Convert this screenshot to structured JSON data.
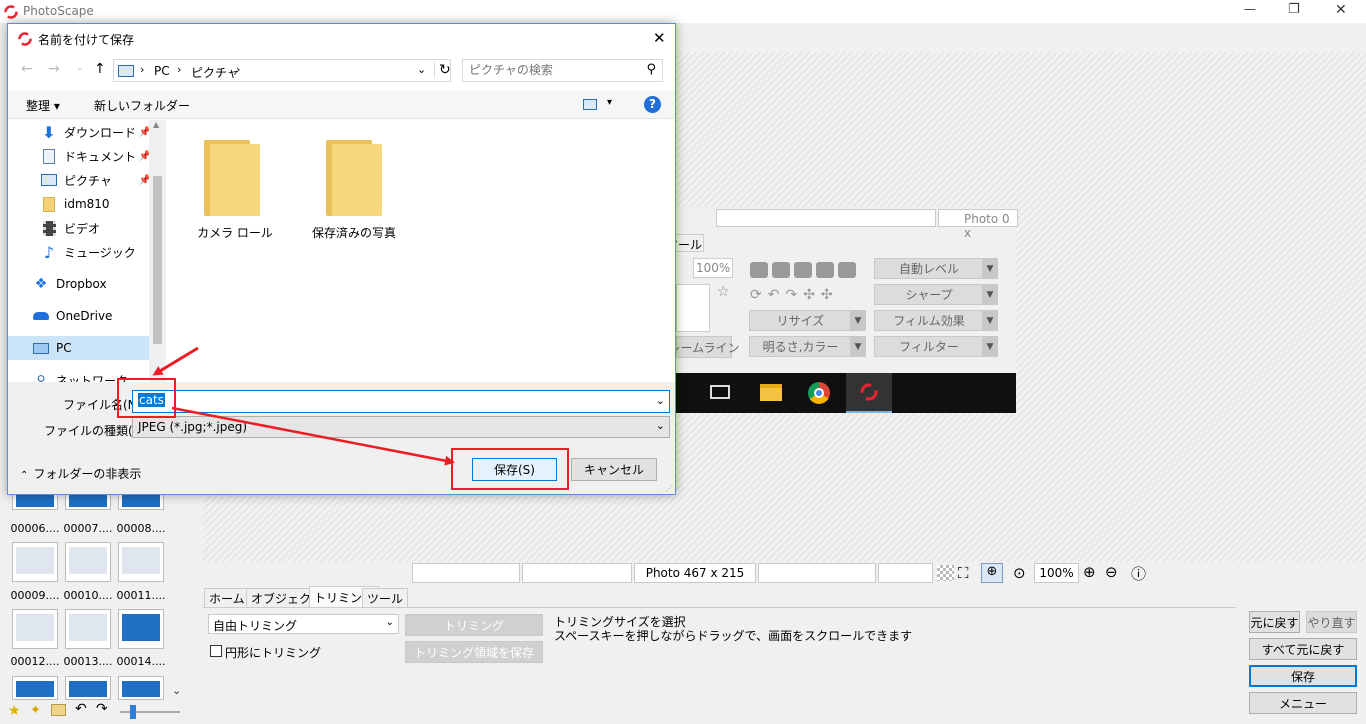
{
  "app": {
    "title": "PhotoScape",
    "win_min": "—",
    "win_max": "❐",
    "win_close": "✕"
  },
  "editor": {
    "info_photo": "Photo 467 x 215",
    "zoom": "100%",
    "tabs": [
      "ホーム",
      "オブジェクト",
      "トリミング",
      "ツール"
    ],
    "crop_select": "自由トリミング",
    "crop_btn": "トリミング",
    "crop_save_btn": "トリミング領域を保存",
    "circle_crop": "円形にトリミング",
    "hint_line1": "トリミングサイズを選択",
    "hint_line2": "スペースキーを押しながらドラッグで、画面をスクロールできます",
    "undo": "元に戻す",
    "redo": "やり直す",
    "undo_all": "すべて元に戻す",
    "save": "保存",
    "menu": "メニュー"
  },
  "inner": {
    "photo_info": "Photo 0 x",
    "tab_partial": "ツール",
    "zoom": "100%",
    "auto_level": "自動レベル",
    "sharpen": "シャープ",
    "resize": "リサイズ",
    "film": "フィルム効果",
    "bright": "明るさ,カラー",
    "filter": "フィルター",
    "frame_partial": "レームライン"
  },
  "thumbs": {
    "labels": [
      "00006....",
      "00007....",
      "00008....",
      "00009....",
      "00010....",
      "00011....",
      "00012....",
      "00013....",
      "00014...."
    ]
  },
  "dialog": {
    "title": "名前を付けて保存",
    "close": "✕",
    "breadcrumb": [
      "PC",
      "ピクチャ"
    ],
    "search_placeholder": "ピクチャの検索",
    "organize": "整理",
    "new_folder": "新しいフォルダー",
    "help": "?",
    "nav": {
      "download": "ダウンロード",
      "documents": "ドキュメント",
      "pictures": "ピクチャ",
      "idm": "idm810",
      "video": "ビデオ",
      "music": "ミュージック",
      "dropbox": "Dropbox",
      "onedrive": "OneDrive",
      "pc": "PC",
      "network": "ネットワーク"
    },
    "folders": [
      "カメラ ロール",
      "保存済みの写真"
    ],
    "filename_label": "ファイル名(N):",
    "filename_value": "cats",
    "filetype_label": "ファイルの種類(T):",
    "filetype_value": "JPEG (*.jpg;*.jpeg)",
    "hide_folders": "フォルダーの非表示",
    "save_btn": "保存(S)",
    "cancel_btn": "キャンセル"
  },
  "colors": {
    "annotation": "#ee1c25",
    "accent": "#0078d7",
    "folder": "#f3d27a"
  }
}
